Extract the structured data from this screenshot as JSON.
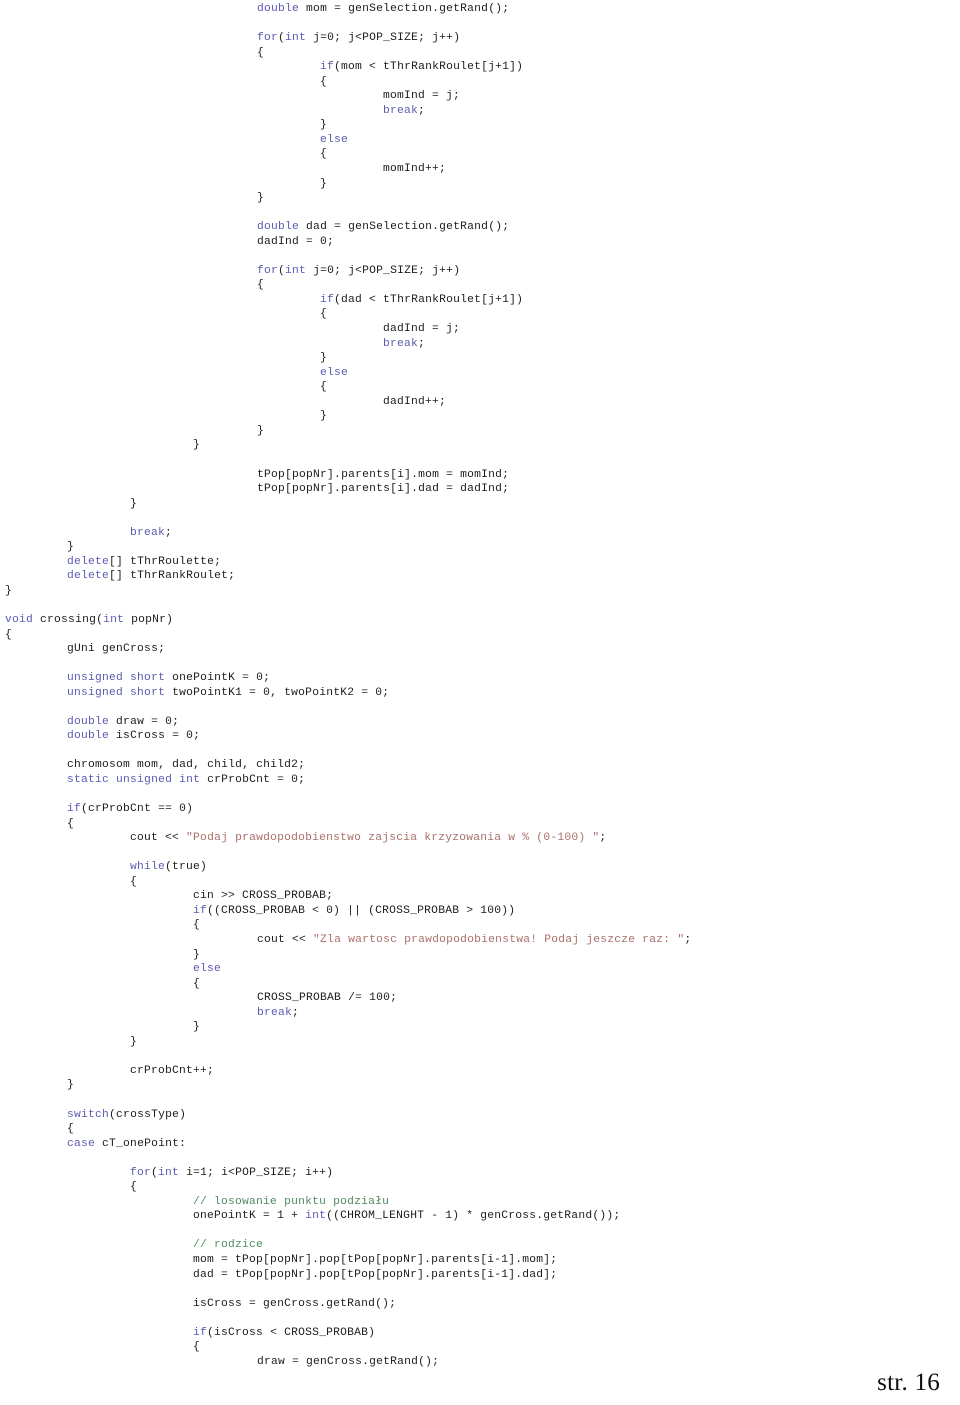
{
  "document": {
    "type": "source-code-listing",
    "language": "C++",
    "page_footer": "str. 16",
    "colors": {
      "keyword": "#5b5bb0",
      "string": "#a9706b",
      "comment": "#4f8a63",
      "plain": "#1c1c1c",
      "background": "#ffffff"
    }
  },
  "code": {
    "lines": [
      {
        "indent": 4,
        "tokens": [
          {
            "t": "kw",
            "v": "double"
          },
          {
            "t": "pln",
            "v": " mom = genSelection.getRand();"
          }
        ]
      },
      {
        "indent": 0,
        "tokens": []
      },
      {
        "indent": 4,
        "tokens": [
          {
            "t": "kw",
            "v": "for"
          },
          {
            "t": "pln",
            "v": "("
          },
          {
            "t": "kw",
            "v": "int"
          },
          {
            "t": "pln",
            "v": " j=0; j<POP_SIZE; j++)"
          }
        ]
      },
      {
        "indent": 4,
        "tokens": [
          {
            "t": "pln",
            "v": "{"
          }
        ]
      },
      {
        "indent": 5,
        "tokens": [
          {
            "t": "kw",
            "v": "if"
          },
          {
            "t": "pln",
            "v": "(mom < tThrRankRoulet[j+1])"
          }
        ]
      },
      {
        "indent": 5,
        "tokens": [
          {
            "t": "pln",
            "v": "{"
          }
        ]
      },
      {
        "indent": 6,
        "tokens": [
          {
            "t": "pln",
            "v": "momInd = j;"
          }
        ]
      },
      {
        "indent": 6,
        "tokens": [
          {
            "t": "kw",
            "v": "break"
          },
          {
            "t": "pln",
            "v": ";"
          }
        ]
      },
      {
        "indent": 5,
        "tokens": [
          {
            "t": "pln",
            "v": "}"
          }
        ]
      },
      {
        "indent": 5,
        "tokens": [
          {
            "t": "kw",
            "v": "else"
          }
        ]
      },
      {
        "indent": 5,
        "tokens": [
          {
            "t": "pln",
            "v": "{"
          }
        ]
      },
      {
        "indent": 6,
        "tokens": [
          {
            "t": "pln",
            "v": "momInd++;"
          }
        ]
      },
      {
        "indent": 5,
        "tokens": [
          {
            "t": "pln",
            "v": "}"
          }
        ]
      },
      {
        "indent": 4,
        "tokens": [
          {
            "t": "pln",
            "v": "}"
          }
        ]
      },
      {
        "indent": 0,
        "tokens": []
      },
      {
        "indent": 4,
        "tokens": [
          {
            "t": "kw",
            "v": "double"
          },
          {
            "t": "pln",
            "v": " dad = genSelection.getRand();"
          }
        ]
      },
      {
        "indent": 4,
        "tokens": [
          {
            "t": "pln",
            "v": "dadInd = 0;"
          }
        ]
      },
      {
        "indent": 0,
        "tokens": []
      },
      {
        "indent": 4,
        "tokens": [
          {
            "t": "kw",
            "v": "for"
          },
          {
            "t": "pln",
            "v": "("
          },
          {
            "t": "kw",
            "v": "int"
          },
          {
            "t": "pln",
            "v": " j=0; j<POP_SIZE; j++)"
          }
        ]
      },
      {
        "indent": 4,
        "tokens": [
          {
            "t": "pln",
            "v": "{"
          }
        ]
      },
      {
        "indent": 5,
        "tokens": [
          {
            "t": "kw",
            "v": "if"
          },
          {
            "t": "pln",
            "v": "(dad < tThrRankRoulet[j+1])"
          }
        ]
      },
      {
        "indent": 5,
        "tokens": [
          {
            "t": "pln",
            "v": "{"
          }
        ]
      },
      {
        "indent": 6,
        "tokens": [
          {
            "t": "pln",
            "v": "dadInd = j;"
          }
        ]
      },
      {
        "indent": 6,
        "tokens": [
          {
            "t": "kw",
            "v": "break"
          },
          {
            "t": "pln",
            "v": ";"
          }
        ]
      },
      {
        "indent": 5,
        "tokens": [
          {
            "t": "pln",
            "v": "}"
          }
        ]
      },
      {
        "indent": 5,
        "tokens": [
          {
            "t": "kw",
            "v": "else"
          }
        ]
      },
      {
        "indent": 5,
        "tokens": [
          {
            "t": "pln",
            "v": "{"
          }
        ]
      },
      {
        "indent": 6,
        "tokens": [
          {
            "t": "pln",
            "v": "dadInd++;"
          }
        ]
      },
      {
        "indent": 5,
        "tokens": [
          {
            "t": "pln",
            "v": "}"
          }
        ]
      },
      {
        "indent": 4,
        "tokens": [
          {
            "t": "pln",
            "v": "}"
          }
        ]
      },
      {
        "indent": 3,
        "tokens": [
          {
            "t": "pln",
            "v": "}"
          }
        ]
      },
      {
        "indent": 0,
        "tokens": []
      },
      {
        "indent": 4,
        "tokens": [
          {
            "t": "pln",
            "v": "tPop[popNr].parents[i].mom = momInd;"
          }
        ]
      },
      {
        "indent": 4,
        "tokens": [
          {
            "t": "pln",
            "v": "tPop[popNr].parents[i].dad = dadInd;"
          }
        ]
      },
      {
        "indent": 2,
        "tokens": [
          {
            "t": "pln",
            "v": "}"
          }
        ]
      },
      {
        "indent": 0,
        "tokens": []
      },
      {
        "indent": 2,
        "tokens": [
          {
            "t": "kw",
            "v": "break"
          },
          {
            "t": "pln",
            "v": ";"
          }
        ]
      },
      {
        "indent": 1,
        "tokens": [
          {
            "t": "pln",
            "v": "}"
          }
        ]
      },
      {
        "indent": 1,
        "tokens": [
          {
            "t": "kw",
            "v": "delete"
          },
          {
            "t": "pln",
            "v": "[] tThrRoulette;"
          }
        ]
      },
      {
        "indent": 1,
        "tokens": [
          {
            "t": "kw",
            "v": "delete"
          },
          {
            "t": "pln",
            "v": "[] tThrRankRoulet;"
          }
        ]
      },
      {
        "indent": 0,
        "tokens": [
          {
            "t": "pln",
            "v": "}"
          }
        ]
      },
      {
        "indent": 0,
        "tokens": []
      },
      {
        "indent": 0,
        "tokens": [
          {
            "t": "kw",
            "v": "void"
          },
          {
            "t": "pln",
            "v": " crossing("
          },
          {
            "t": "kw",
            "v": "int"
          },
          {
            "t": "pln",
            "v": " popNr)"
          }
        ]
      },
      {
        "indent": 0,
        "tokens": [
          {
            "t": "pln",
            "v": "{"
          }
        ]
      },
      {
        "indent": 1,
        "tokens": [
          {
            "t": "pln",
            "v": "gUni genCross;"
          }
        ]
      },
      {
        "indent": 0,
        "tokens": []
      },
      {
        "indent": 1,
        "tokens": [
          {
            "t": "kw",
            "v": "unsigned short"
          },
          {
            "t": "pln",
            "v": " onePointK = 0;"
          }
        ]
      },
      {
        "indent": 1,
        "tokens": [
          {
            "t": "kw",
            "v": "unsigned short"
          },
          {
            "t": "pln",
            "v": " twoPointK1 = 0, twoPointK2 = 0;"
          }
        ]
      },
      {
        "indent": 0,
        "tokens": []
      },
      {
        "indent": 1,
        "tokens": [
          {
            "t": "kw",
            "v": "double"
          },
          {
            "t": "pln",
            "v": " draw = 0;"
          }
        ]
      },
      {
        "indent": 1,
        "tokens": [
          {
            "t": "kw",
            "v": "double"
          },
          {
            "t": "pln",
            "v": " isCross = 0;"
          }
        ]
      },
      {
        "indent": 0,
        "tokens": []
      },
      {
        "indent": 1,
        "tokens": [
          {
            "t": "pln",
            "v": "chromosom mom, dad, child, child2;"
          }
        ]
      },
      {
        "indent": 1,
        "tokens": [
          {
            "t": "kw",
            "v": "static unsigned int"
          },
          {
            "t": "pln",
            "v": " crProbCnt = 0;"
          }
        ]
      },
      {
        "indent": 0,
        "tokens": []
      },
      {
        "indent": 1,
        "tokens": [
          {
            "t": "kw",
            "v": "if"
          },
          {
            "t": "pln",
            "v": "(crProbCnt == 0)"
          }
        ]
      },
      {
        "indent": 1,
        "tokens": [
          {
            "t": "pln",
            "v": "{"
          }
        ]
      },
      {
        "indent": 2,
        "tokens": [
          {
            "t": "pln",
            "v": "cout << "
          },
          {
            "t": "str",
            "v": "\"Podaj prawdopodobienstwo zajscia krzyzowania w % (0-100) \""
          },
          {
            "t": "pln",
            "v": ";"
          }
        ]
      },
      {
        "indent": 0,
        "tokens": []
      },
      {
        "indent": 2,
        "tokens": [
          {
            "t": "kw",
            "v": "while"
          },
          {
            "t": "pln",
            "v": "(true)"
          }
        ]
      },
      {
        "indent": 2,
        "tokens": [
          {
            "t": "pln",
            "v": "{"
          }
        ]
      },
      {
        "indent": 3,
        "tokens": [
          {
            "t": "pln",
            "v": "cin >> CROSS_PROBAB;"
          }
        ]
      },
      {
        "indent": 3,
        "tokens": [
          {
            "t": "kw",
            "v": "if"
          },
          {
            "t": "pln",
            "v": "((CROSS_PROBAB < 0) || (CROSS_PROBAB > 100))"
          }
        ]
      },
      {
        "indent": 3,
        "tokens": [
          {
            "t": "pln",
            "v": "{"
          }
        ]
      },
      {
        "indent": 4,
        "tokens": [
          {
            "t": "pln",
            "v": "cout << "
          },
          {
            "t": "str",
            "v": "\"Zla wartosc prawdopodobienstwa! Podaj jeszcze raz: \""
          },
          {
            "t": "pln",
            "v": ";"
          }
        ]
      },
      {
        "indent": 3,
        "tokens": [
          {
            "t": "pln",
            "v": "}"
          }
        ]
      },
      {
        "indent": 3,
        "tokens": [
          {
            "t": "kw",
            "v": "else"
          }
        ]
      },
      {
        "indent": 3,
        "tokens": [
          {
            "t": "pln",
            "v": "{"
          }
        ]
      },
      {
        "indent": 4,
        "tokens": [
          {
            "t": "pln",
            "v": "CROSS_PROBAB /= 100;"
          }
        ]
      },
      {
        "indent": 4,
        "tokens": [
          {
            "t": "kw",
            "v": "break"
          },
          {
            "t": "pln",
            "v": ";"
          }
        ]
      },
      {
        "indent": 3,
        "tokens": [
          {
            "t": "pln",
            "v": "}"
          }
        ]
      },
      {
        "indent": 2,
        "tokens": [
          {
            "t": "pln",
            "v": "}"
          }
        ]
      },
      {
        "indent": 0,
        "tokens": []
      },
      {
        "indent": 2,
        "tokens": [
          {
            "t": "pln",
            "v": "crProbCnt++;"
          }
        ]
      },
      {
        "indent": 1,
        "tokens": [
          {
            "t": "pln",
            "v": "}"
          }
        ]
      },
      {
        "indent": 0,
        "tokens": []
      },
      {
        "indent": 1,
        "tokens": [
          {
            "t": "kw",
            "v": "switch"
          },
          {
            "t": "pln",
            "v": "(crossType)"
          }
        ]
      },
      {
        "indent": 1,
        "tokens": [
          {
            "t": "pln",
            "v": "{"
          }
        ]
      },
      {
        "indent": 1,
        "tokens": [
          {
            "t": "kw",
            "v": "case"
          },
          {
            "t": "pln",
            "v": " cT_onePoint:"
          }
        ]
      },
      {
        "indent": 0,
        "tokens": []
      },
      {
        "indent": 2,
        "tokens": [
          {
            "t": "kw",
            "v": "for"
          },
          {
            "t": "pln",
            "v": "("
          },
          {
            "t": "kw",
            "v": "int"
          },
          {
            "t": "pln",
            "v": " i=1; i<POP_SIZE; i++)"
          }
        ]
      },
      {
        "indent": 2,
        "tokens": [
          {
            "t": "pln",
            "v": "{"
          }
        ]
      },
      {
        "indent": 3,
        "tokens": [
          {
            "t": "cmt",
            "v": "// losowanie punktu podziału"
          }
        ]
      },
      {
        "indent": 3,
        "tokens": [
          {
            "t": "pln",
            "v": "onePointK = 1 + "
          },
          {
            "t": "kw",
            "v": "int"
          },
          {
            "t": "pln",
            "v": "((CHROM_LENGHT - 1) * genCross.getRand());"
          }
        ]
      },
      {
        "indent": 0,
        "tokens": []
      },
      {
        "indent": 3,
        "tokens": [
          {
            "t": "cmt",
            "v": "// rodzice"
          }
        ]
      },
      {
        "indent": 3,
        "tokens": [
          {
            "t": "pln",
            "v": "mom = tPop[popNr].pop[tPop[popNr].parents[i-1].mom];"
          }
        ]
      },
      {
        "indent": 3,
        "tokens": [
          {
            "t": "pln",
            "v": "dad = tPop[popNr].pop[tPop[popNr].parents[i-1].dad];"
          }
        ]
      },
      {
        "indent": 0,
        "tokens": []
      },
      {
        "indent": 3,
        "tokens": [
          {
            "t": "pln",
            "v": "isCross = genCross.getRand();"
          }
        ]
      },
      {
        "indent": 0,
        "tokens": []
      },
      {
        "indent": 3,
        "tokens": [
          {
            "t": "kw",
            "v": "if"
          },
          {
            "t": "pln",
            "v": "(isCross < CROSS_PROBAB)"
          }
        ]
      },
      {
        "indent": 3,
        "tokens": [
          {
            "t": "pln",
            "v": "{"
          }
        ]
      },
      {
        "indent": 4,
        "tokens": [
          {
            "t": "pln",
            "v": "draw = genCross.getRand();"
          }
        ]
      }
    ]
  }
}
